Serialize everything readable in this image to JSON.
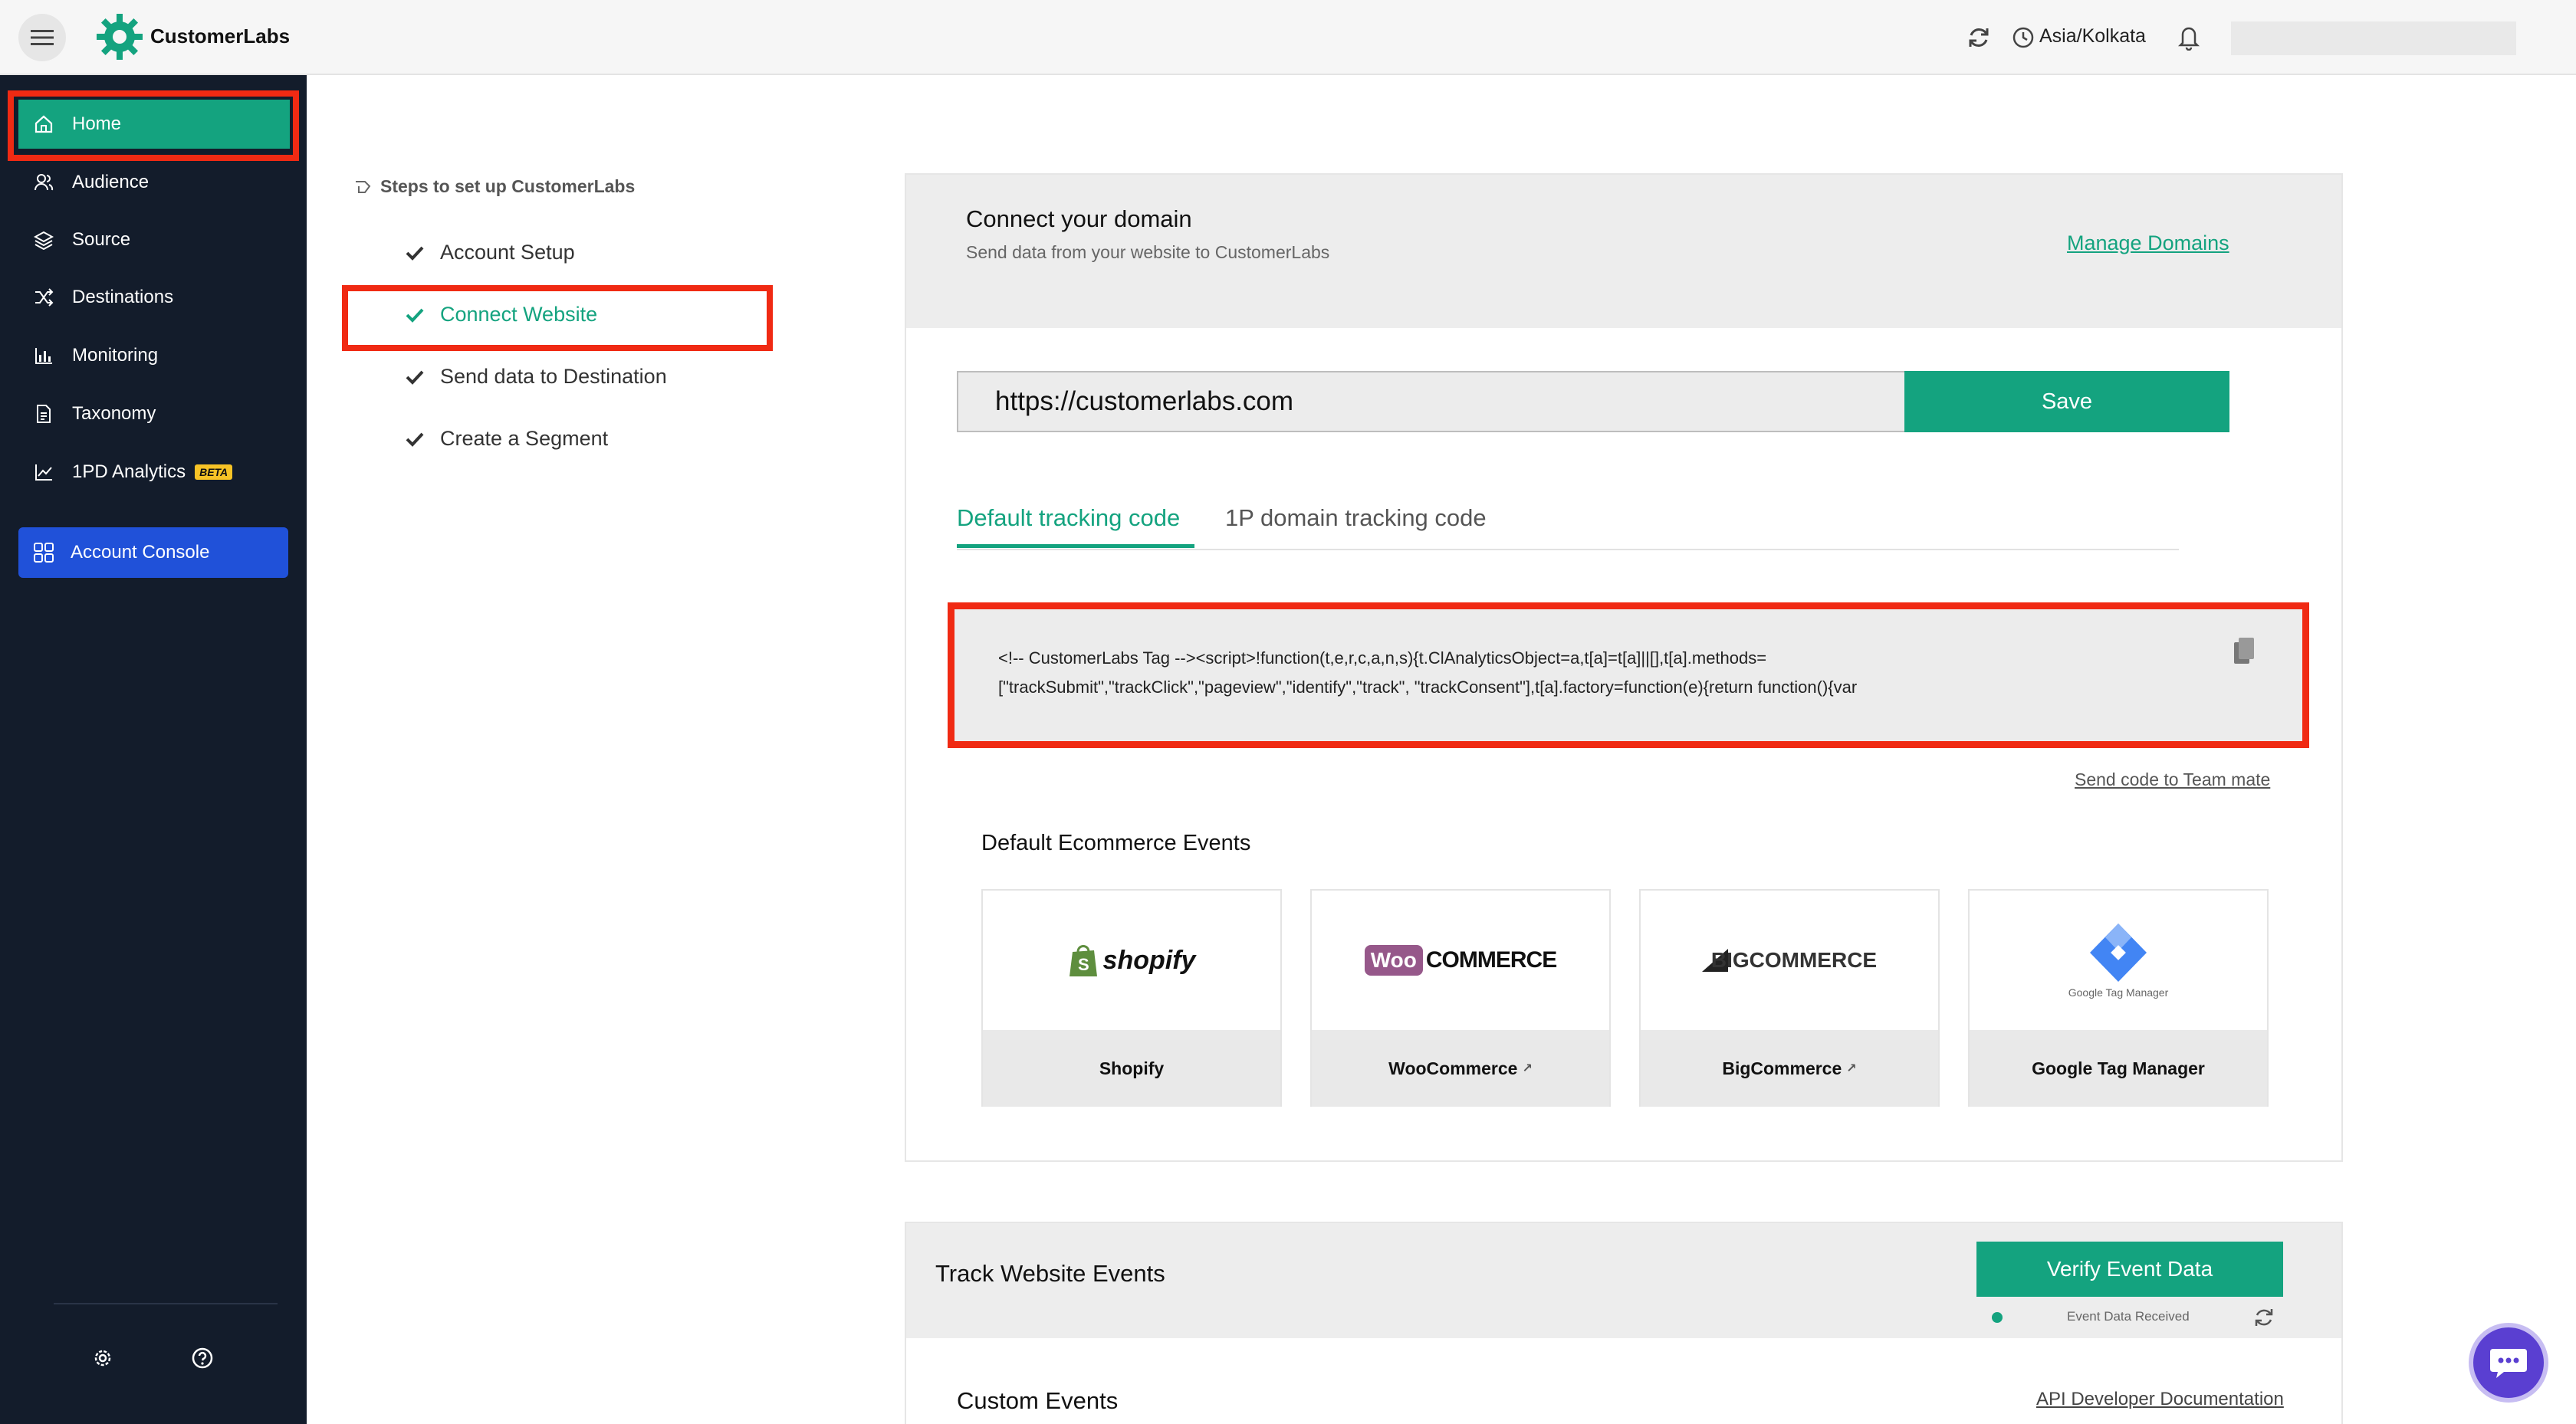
{
  "header": {
    "brand": "CustomerLabs",
    "timezone": "Asia/Kolkata"
  },
  "sidebar": {
    "items": [
      {
        "label": "Home",
        "icon": "home-icon"
      },
      {
        "label": "Audience",
        "icon": "users-icon"
      },
      {
        "label": "Source",
        "icon": "layers-icon"
      },
      {
        "label": "Destinations",
        "icon": "shuffle-icon"
      },
      {
        "label": "Monitoring",
        "icon": "bar-chart-icon"
      },
      {
        "label": "Taxonomy",
        "icon": "document-icon"
      },
      {
        "label": "1PD Analytics",
        "icon": "line-chart-icon",
        "badge": "BETA"
      }
    ],
    "console_label": "Account Console"
  },
  "steps": {
    "title": "Steps to set up CustomerLabs",
    "items": [
      {
        "label": "Account Setup"
      },
      {
        "label": "Connect Website"
      },
      {
        "label": "Send data to Destination"
      },
      {
        "label": "Create a Segment"
      }
    ]
  },
  "domain_card": {
    "title": "Connect your domain",
    "subtitle": "Send data from your website to CustomerLabs",
    "manage_link": "Manage Domains",
    "url_value": "https://customerlabs.com",
    "save_label": "Save",
    "tabs": [
      "Default tracking code",
      "1P domain tracking code"
    ],
    "code_line1": "<!-- CustomerLabs Tag --><script>!function(t,e,r,c,a,n,s){t.ClAnalyticsObject=a,t[a]=t[a]||[],t[a].methods=",
    "code_line2": "[\"trackSubmit\",\"trackClick\",\"pageview\",\"identify\",\"track\", \"trackConsent\"],t[a].factory=function(e){return function(){var",
    "send_code_link": "Send code to Team mate",
    "ecommerce_title": "Default Ecommerce Events",
    "platforms": [
      {
        "label": "Shopify",
        "logo_text": "shopify"
      },
      {
        "label": "WooCommerce",
        "logo_text_a": "Woo",
        "logo_text_b": "COMMERCE"
      },
      {
        "label": "BigCommerce",
        "logo_text": "BIGCOMMERCE"
      },
      {
        "label": "Google Tag Manager",
        "logo_text": "Google Tag Manager"
      }
    ]
  },
  "track_card": {
    "title": "Track Website Events",
    "verify_label": "Verify Event Data",
    "status": "Event Data Received",
    "custom_title": "Custom Events",
    "api_link": "API Developer Documentation"
  },
  "colors": {
    "accent": "#14a37f",
    "sidebar_bg": "#131c2b",
    "console_blue": "#2051d9",
    "highlight_red": "#f02a13"
  }
}
